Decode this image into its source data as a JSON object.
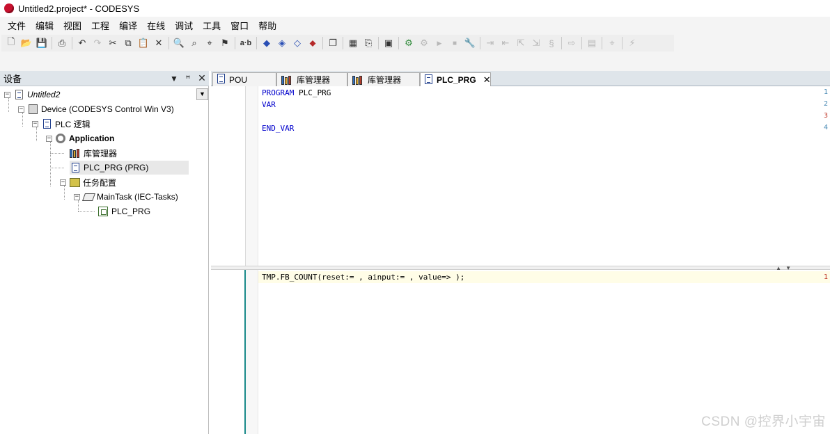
{
  "window": {
    "title": "Untitled2.project* - CODESYS"
  },
  "menu": {
    "items": [
      "文件",
      "编辑",
      "视图",
      "工程",
      "编译",
      "在线",
      "调试",
      "工具",
      "窗口",
      "帮助"
    ]
  },
  "toolbar": {
    "buttons": [
      {
        "icon": "new-file-icon",
        "glyph": "🗋"
      },
      {
        "icon": "open-folder-icon",
        "glyph": "📂"
      },
      {
        "icon": "save-icon",
        "glyph": "💾"
      },
      {
        "icon": "print-icon",
        "glyph": "⎙"
      },
      {
        "icon": "undo-icon",
        "glyph": "↶"
      },
      {
        "icon": "redo-icon",
        "glyph": "↷"
      },
      {
        "icon": "cut-icon",
        "glyph": "✂"
      },
      {
        "icon": "copy-icon",
        "glyph": "⧉"
      },
      {
        "icon": "paste-icon",
        "glyph": "📋"
      },
      {
        "icon": "delete-icon",
        "glyph": "✕"
      },
      {
        "icon": "find-icon",
        "glyph": "🔍"
      },
      {
        "icon": "find-next-icon",
        "glyph": "⌕"
      },
      {
        "icon": "find-replace-icon",
        "glyph": "⌖"
      },
      {
        "icon": "bookmark-icon",
        "glyph": "⚑"
      },
      {
        "icon": "text-ab-icon",
        "glyph": "a·b"
      },
      {
        "icon": "breakpoint-icon",
        "glyph": "◆"
      },
      {
        "icon": "breakpoint-add-icon",
        "glyph": "◈"
      },
      {
        "icon": "breakpoint-toggle-icon",
        "glyph": "◇"
      },
      {
        "icon": "breakpoint-remove-icon",
        "glyph": "⬥"
      },
      {
        "icon": "windows-icon",
        "glyph": "❐"
      },
      {
        "icon": "grid-icon",
        "glyph": "▦"
      },
      {
        "icon": "file-export-icon",
        "glyph": "⎘"
      },
      {
        "icon": "build-icon",
        "glyph": "▣"
      },
      {
        "icon": "login-icon",
        "glyph": "⚙"
      },
      {
        "icon": "logout-icon",
        "glyph": "⚙"
      },
      {
        "icon": "run-icon",
        "glyph": "▶"
      },
      {
        "icon": "stop-icon",
        "glyph": "■"
      },
      {
        "icon": "reset-icon",
        "glyph": "🔧"
      },
      {
        "icon": "step-over-icon",
        "glyph": "⇥"
      },
      {
        "icon": "step-into-icon",
        "glyph": "⇤"
      },
      {
        "icon": "step-out-icon",
        "glyph": "⇱"
      },
      {
        "icon": "set-next-icon",
        "glyph": "⇲"
      },
      {
        "icon": "watch-icon",
        "glyph": "§"
      },
      {
        "icon": "write-values-icon",
        "glyph": "⇨"
      },
      {
        "icon": "force-values-icon",
        "glyph": "▤"
      },
      {
        "icon": "unforce-icon",
        "glyph": "⌖"
      },
      {
        "icon": "flow-control-icon",
        "glyph": "⚡"
      }
    ]
  },
  "devices": {
    "title": "设备",
    "tree": [
      {
        "label": "Untitled2",
        "level": 0,
        "icon": "project-icon"
      },
      {
        "label": "Device (CODESYS Control Win V3)",
        "level": 1,
        "icon": "device-icon"
      },
      {
        "label": "PLC 逻辑",
        "level": 2,
        "icon": "plc-logic-icon"
      },
      {
        "label": "Application",
        "level": 3,
        "icon": "application-gear-icon"
      },
      {
        "label": "库管理器",
        "level": 4,
        "icon": "library-manager-icon"
      },
      {
        "label": "PLC_PRG (PRG)",
        "level": 4,
        "icon": "pou-document-icon"
      },
      {
        "label": "任务配置",
        "level": 4,
        "icon": "task-config-icon"
      },
      {
        "label": "MainTask (IEC-Tasks)",
        "level": 5,
        "icon": "task-icon"
      },
      {
        "label": "PLC_PRG",
        "level": 6,
        "icon": "program-call-icon"
      }
    ]
  },
  "editor": {
    "tabs": [
      {
        "label": "POU",
        "icon": "pou-document-icon"
      },
      {
        "label": "库管理器",
        "icon": "library-manager-icon"
      },
      {
        "label": "库管理器",
        "icon": "library-manager-icon"
      },
      {
        "label": "PLC_PRG",
        "icon": "pou-document-icon",
        "active": true
      }
    ],
    "declaration": {
      "lines": [
        {
          "n": "1",
          "text": "PROGRAM PLC_PRG"
        },
        {
          "n": "2",
          "text": "VAR"
        },
        {
          "n": "3",
          "text": ""
        },
        {
          "n": "4",
          "text": "END_VAR"
        }
      ]
    },
    "implementation": {
      "lines": [
        {
          "n": "1",
          "text": "TMP.FB_COUNT(reset:= , ainput:= , value=> );"
        }
      ]
    }
  },
  "watermark": "CSDN @控界小宇宙"
}
